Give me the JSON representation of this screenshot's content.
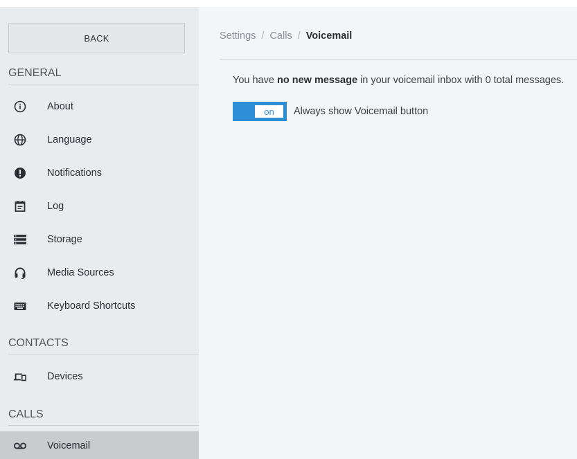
{
  "sidebar": {
    "back_label": "BACK",
    "sections": {
      "general": "GENERAL",
      "contacts": "CONTACTS",
      "calls": "CALLS"
    },
    "items": [
      {
        "label": "About",
        "icon": "info-icon"
      },
      {
        "label": "Language",
        "icon": "globe-icon"
      },
      {
        "label": "Notifications",
        "icon": "alert-icon"
      },
      {
        "label": "Log",
        "icon": "log-icon"
      },
      {
        "label": "Storage",
        "icon": "storage-icon"
      },
      {
        "label": "Media Sources",
        "icon": "headphones-icon"
      },
      {
        "label": "Keyboard Shortcuts",
        "icon": "keyboard-icon"
      },
      {
        "label": "Devices",
        "icon": "devices-icon"
      },
      {
        "label": "Voicemail",
        "icon": "voicemail-icon",
        "active": true
      }
    ]
  },
  "breadcrumb": {
    "items": [
      "Settings",
      "Calls",
      "Voicemail"
    ],
    "separator": "/"
  },
  "voicemail": {
    "message_prefix": "You have ",
    "message_bold": "no new message",
    "message_suffix": " in your voicemail inbox with 0 total messages.",
    "toggle_state": "on",
    "toggle_label": "Always show Voicemail button"
  },
  "colors": {
    "accent": "#2e8fd6",
    "sidebar_bg": "#e8ecee",
    "active_item_bg": "#c9ccce",
    "main_bg": "#f4f5f6"
  }
}
